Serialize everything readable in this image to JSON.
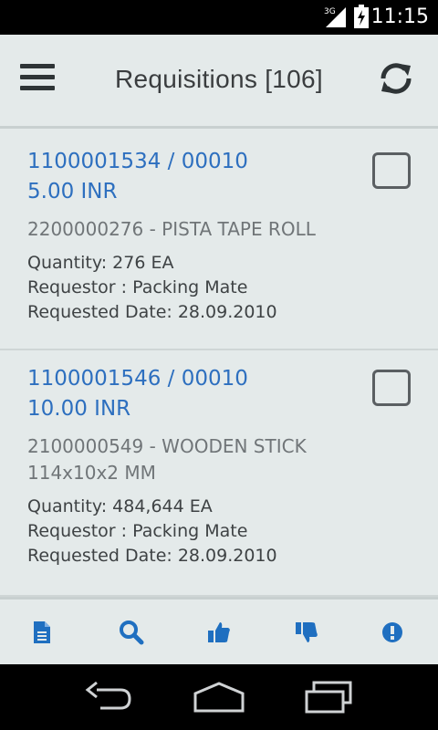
{
  "status_bar": {
    "network": "3G",
    "time": "11:15"
  },
  "app_bar": {
    "title": "Requisitions [106]",
    "menu_icon": "hamburger-menu-icon",
    "refresh_icon": "refresh-icon"
  },
  "requisitions": [
    {
      "id": "1100001534 / 00010",
      "amount": "5.00 INR",
      "material": "2200000276 - PISTA TAPE ROLL",
      "quantity": "Quantity: 276 EA",
      "requestor": "Requestor : Packing Mate",
      "requested_date": "Requested Date: 28.09.2010",
      "checked": false
    },
    {
      "id": "1100001546 / 00010",
      "amount": "10.00 INR",
      "material": "2100000549 - WOODEN STICK 114x10x2 MM",
      "quantity": "Quantity: 484,644 EA",
      "requestor": "Requestor : Packing Mate",
      "requested_date": "Requested Date: 28.09.2010",
      "checked": false
    }
  ],
  "toolbar": {
    "accent": "#1f6fc0",
    "icons": [
      "document-icon",
      "search-icon",
      "thumbs-up-icon",
      "thumbs-down-icon",
      "alert-icon"
    ]
  },
  "nav_bar": {
    "icons": [
      "back-icon",
      "home-icon",
      "recent-apps-icon"
    ]
  }
}
